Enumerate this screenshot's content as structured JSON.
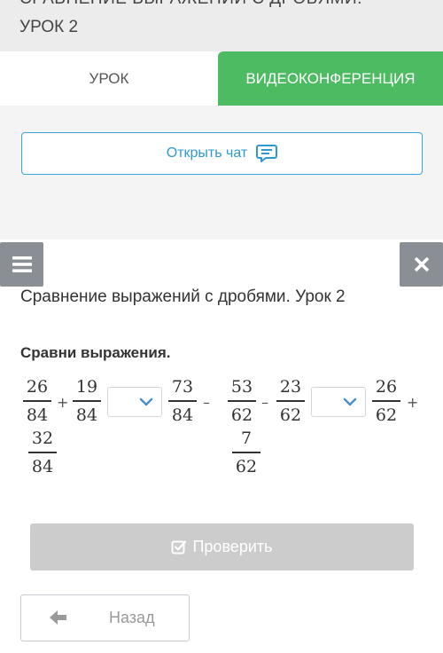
{
  "header": {
    "title_line1": "СРАВНЕНИЕ ВЫРАЖЕНИЙ С ДРОБЯМИ.",
    "title_line2": "УРОК 2"
  },
  "tabs": [
    {
      "label": "УРОК"
    },
    {
      "label": "ВИДЕОКОНФЕРЕНЦИЯ"
    }
  ],
  "chat": {
    "label": "Открыть чат",
    "icon": "chat-bubble-icon"
  },
  "card": {
    "title": "Сравнение выражений с дробями. Урок 2",
    "prompt": "Сравни выражения.",
    "fractions": [
      {
        "num": "26",
        "den": "84"
      },
      {
        "num": "19",
        "den": "84"
      },
      {
        "num": "73",
        "den": "84"
      },
      {
        "num": "53",
        "den": "62"
      },
      {
        "num": "23",
        "den": "62"
      },
      {
        "num": "26",
        "den": "62"
      },
      {
        "num": "32",
        "den": "84"
      },
      {
        "num": "7",
        "den": "62"
      }
    ],
    "operators": [
      "+",
      "–",
      "–",
      "+"
    ],
    "selects": [
      {
        "value": ""
      },
      {
        "value": ""
      }
    ]
  },
  "check_button": {
    "label": "Проверить",
    "icon": "check-square-icon"
  },
  "back_button": {
    "label": "Назад",
    "icon": "arrow-left-icon"
  },
  "colors": {
    "accent_green": "#4dbb61",
    "accent_blue": "#3aa5dc",
    "disabled_gray": "#cccccc",
    "tool_gray": "#8a8f96"
  }
}
